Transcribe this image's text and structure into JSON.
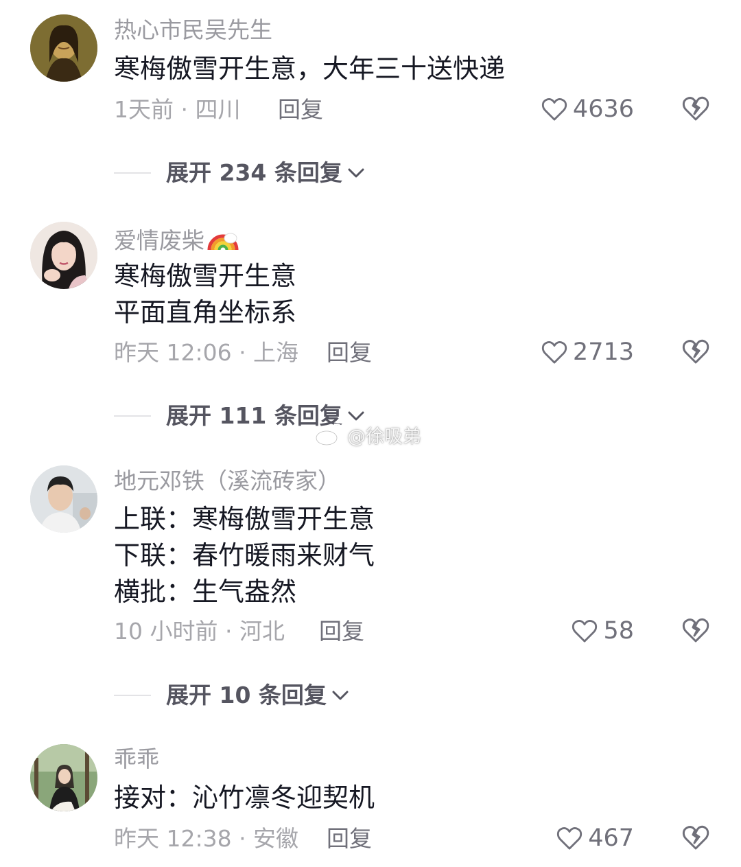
{
  "comments": [
    {
      "username": "热心市民吴先生",
      "lines": [
        "寒梅傲雪开生意，大年三十送快递"
      ],
      "meta": "1天前 · 四川",
      "reply_label": "回复",
      "likes": "4636",
      "expand_label": "展开 234 条回复"
    },
    {
      "username": "爱情废柴",
      "lines": [
        "寒梅傲雪开生意",
        "平面直角坐标系"
      ],
      "meta": "昨天 12:06 · 上海",
      "reply_label": "回复",
      "likes": "2713",
      "expand_label": "展开 111 条回复"
    },
    {
      "username": "地元邓铁（溪流砖家）",
      "lines": [
        "上联：寒梅傲雪开生意",
        "下联：春竹暖雨来财气",
        "横批：生气盎然"
      ],
      "meta": "10 小时前 · 河北",
      "reply_label": "回复",
      "likes": "58",
      "expand_label": "展开 10 条回复"
    },
    {
      "username": "乖乖",
      "lines": [
        "接对：沁竹凛冬迎契机"
      ],
      "meta": "昨天 12:38 · 安徽",
      "reply_label": "回复",
      "likes": "467"
    }
  ],
  "watermark": "@徐吸弟",
  "icons": {
    "like": "heart-outline-icon",
    "dislike": "broken-heart-icon",
    "expand": "chevron-down-icon",
    "username_badge": "rainbow-emoji",
    "watermark": "weibo-logo-icon"
  },
  "colors": {
    "background": "#ffffff",
    "text_primary": "#161823",
    "text_secondary": "#a6a6ab",
    "icon": "#70707a"
  }
}
